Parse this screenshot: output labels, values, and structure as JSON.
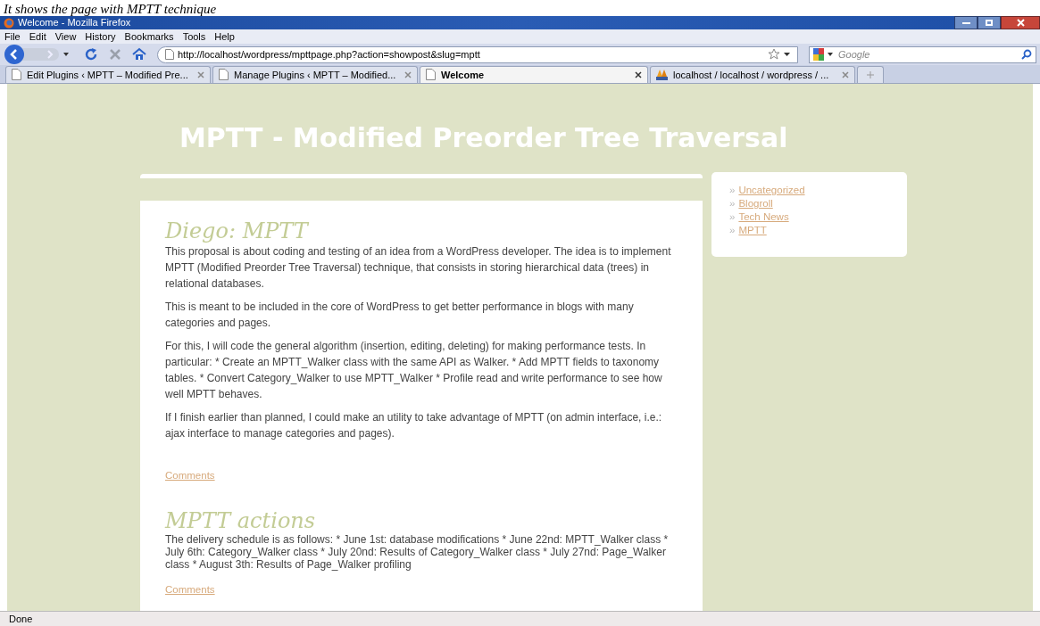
{
  "caption": "It shows the page with MPTT technique",
  "window": {
    "title": "Welcome - Mozilla Firefox"
  },
  "menu": [
    "File",
    "Edit",
    "View",
    "History",
    "Bookmarks",
    "Tools",
    "Help"
  ],
  "address_bar": {
    "value": "http://localhost/wordpress/mpttpage.php?action=showpost&slug=mptt"
  },
  "search": {
    "placeholder": "Google"
  },
  "tabs": [
    {
      "label": "Edit Plugins ‹ MPTT – Modified Pre...",
      "selected": false,
      "kind": "page"
    },
    {
      "label": "Manage Plugins ‹ MPTT – Modified...",
      "selected": false,
      "kind": "page"
    },
    {
      "label": "Welcome",
      "selected": true,
      "kind": "page"
    },
    {
      "label": "localhost / localhost / wordpress / ...",
      "selected": false,
      "kind": "pma"
    }
  ],
  "page": {
    "site_title": "MPTT - Modified Preorder Tree Traversal",
    "posts": [
      {
        "title": "Diego: MPTT",
        "paragraphs": [
          "This proposal is about coding and testing of an idea from a WordPress developer. The idea is to implement MPTT (Modified Preorder Tree Traversal) technique, that consists in storing hierarchical data (trees) in relational databases.",
          "This is meant to be included in the core of WordPress to get better performance in blogs with many categories and pages.",
          "For this, I will code the general algorithm (insertion, editing, deleting) for making performance tests. In particular: * Create an MPTT_Walker class with the same API as Walker. * Add MPTT fields to taxonomy tables. * Convert Category_Walker to use MPTT_Walker * Profile read and write performance to see how well MPTT behaves.",
          "If I finish earlier than planned, I could make an utility to take advantage of MPTT (on admin interface, i.e.: ajax interface to manage categories and pages)."
        ],
        "link": "Comments"
      },
      {
        "title": "MPTT actions",
        "paragraphs": [
          "The delivery schedule is as follows: * June 1st: database modifications * June 22nd: MPTT_Walker class * July 6th: Category_Walker class * July 20nd: Results of Category_Walker class * July 27nd: Page_Walker class * August 3th: Results of Page_Walker profiling"
        ],
        "link": "Comments"
      }
    ],
    "sidebar": [
      {
        "bullet": "»",
        "label": "Uncategorized"
      },
      {
        "bullet": "»",
        "label": "Blogroll"
      },
      {
        "bullet": "»",
        "label": "Tech News"
      },
      {
        "bullet": "»",
        "label": "MPTT"
      }
    ]
  },
  "status_bar": "Done"
}
